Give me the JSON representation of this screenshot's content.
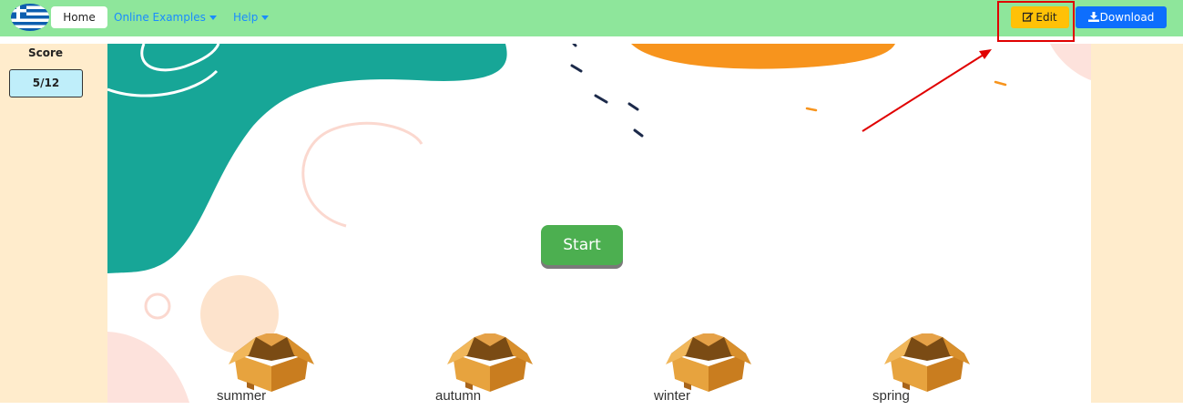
{
  "nav": {
    "home_label": "Home",
    "online_examples_label": "Online Examples",
    "help_label": "Help",
    "edit_label": "Edit",
    "download_label": "Download",
    "icons": {
      "flag": "greece-flag-icon",
      "edit": "edit-icon",
      "download": "download-icon"
    }
  },
  "score": {
    "label": "Score",
    "value": "5/12"
  },
  "game": {
    "start_label": "Start",
    "boxes": [
      {
        "label": "summer"
      },
      {
        "label": "autumn"
      },
      {
        "label": "winter"
      },
      {
        "label": "spring"
      }
    ]
  },
  "colors": {
    "navbar": "#8ee69b",
    "edit_button": "#ffc107",
    "download_button": "#0d6efd",
    "start_button": "#4caf50",
    "side_panels": "#ffeccc",
    "score_box": "#bfeefa",
    "highlight": "#e00000"
  }
}
